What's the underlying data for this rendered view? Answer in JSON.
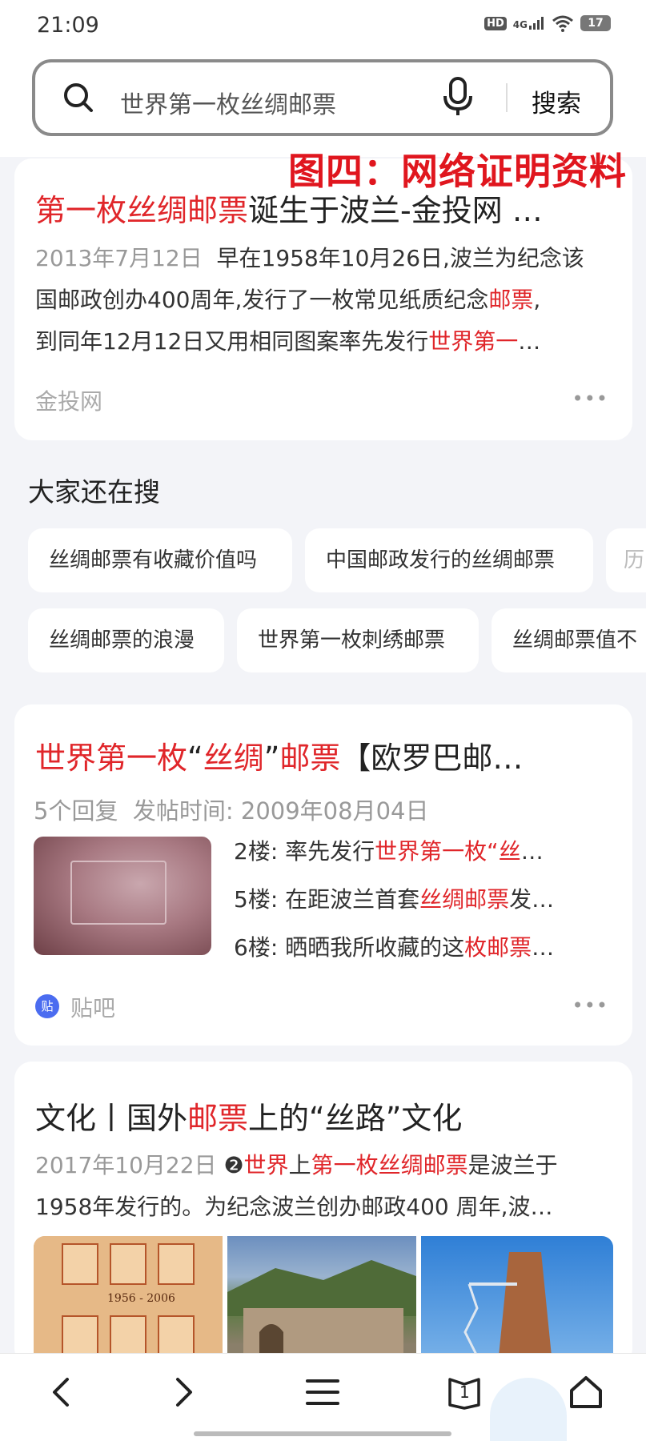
{
  "status_bar": {
    "time": "21:09",
    "hd": "HD",
    "network": "4G",
    "battery": "17"
  },
  "search": {
    "query": "世界第一枚丝绸邮票",
    "button_label": "搜索"
  },
  "overlay_title": "图四：网络证明资料",
  "result1": {
    "title_hl": "第一枚丝绸邮票",
    "title_rest": "诞生于波兰-金投网 …",
    "date": "2013年7月12日",
    "line1": "早在1958年10月26日,波兰为纪念该",
    "line2a": "国邮政创办400周年,发行了一枚常见纸质纪念",
    "line2b": "邮票",
    "line2c": ",",
    "line3a": "到同年12月12日又用相同图案率先发行",
    "line3b": "世界第一",
    "line3c": "…",
    "source": "金投网",
    "more": "•••"
  },
  "related": {
    "heading": "大家还在搜",
    "chips": [
      "丝绸邮票有收藏价值吗",
      "中国邮政发行的丝绸邮票",
      "历",
      "丝绸邮票的浪漫",
      "世界第一枚刺绣邮票",
      "丝绸邮票值不"
    ]
  },
  "result2": {
    "title_a": "世界第一枚",
    "title_b": "“",
    "title_c": "丝绸",
    "title_d": "”",
    "title_e": "邮票",
    "title_f": "【欧罗巴邮…",
    "meta": "5个回复  发帖时间: 2009年08月04日",
    "replies": [
      {
        "a": "2楼: 率先发行",
        "b": "世界第一枚",
        "c": "“",
        "d": "丝",
        "e": "…"
      },
      {
        "a": "5楼: 在距波兰首套",
        "b": "丝绸邮票",
        "c": "发…",
        "d": "",
        "e": ""
      },
      {
        "a": "6楼: 晒晒我所收藏的这",
        "b": "枚邮票",
        "c": "…",
        "d": "",
        "e": ""
      }
    ],
    "source_logo": "贴",
    "source": "贴吧",
    "more": "•••"
  },
  "result3": {
    "title_a": "文化丨国外",
    "title_b": "邮票",
    "title_c": "上的“丝路”文化",
    "date": "2017年10月22日",
    "badge": "❷",
    "s1": "世界",
    "s2": "上",
    "s3": "第一枚丝绸邮票",
    "s4": "是波兰于",
    "line2": "1958年发行的。为纪念波兰创办邮政400 周年,波…",
    "stamp_year": "1956 - 2006"
  },
  "bottom_nav": {
    "tab_count": "1"
  }
}
